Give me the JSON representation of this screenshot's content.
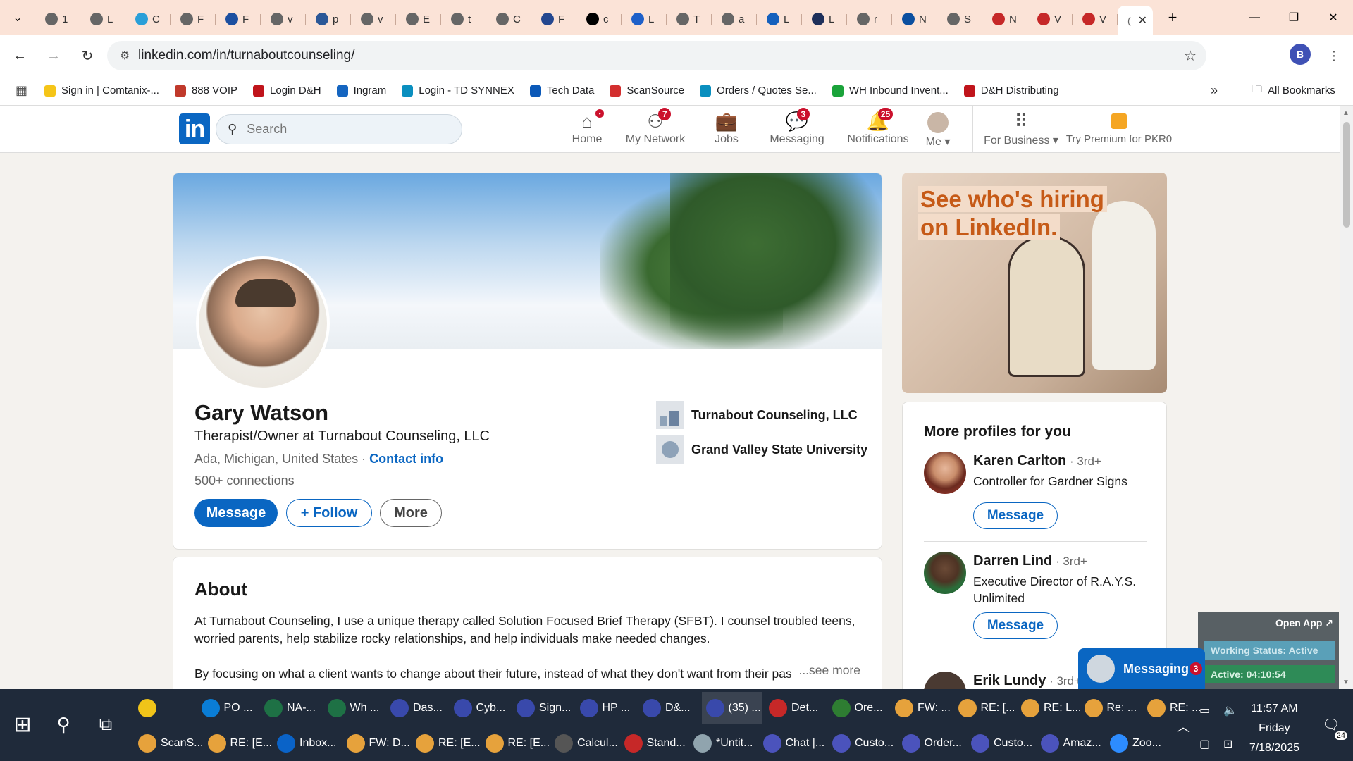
{
  "browser": {
    "url": "linkedin.com/in/turnaboutcounseling/",
    "tabs": [
      {
        "label": "1",
        "color": "#666"
      },
      {
        "label": "L",
        "color": "#666"
      },
      {
        "label": "C",
        "color": "#2a9fd8"
      },
      {
        "label": "F",
        "color": "#666"
      },
      {
        "label": "F",
        "color": "#1c4fa0"
      },
      {
        "label": "v",
        "color": "#666"
      },
      {
        "label": "p",
        "color": "#2b5797"
      },
      {
        "label": "v",
        "color": "#666"
      },
      {
        "label": "E",
        "color": "#666"
      },
      {
        "label": "t",
        "color": "#666"
      },
      {
        "label": "C",
        "color": "#666"
      },
      {
        "label": "F",
        "color": "#24478f"
      },
      {
        "label": "c",
        "color": "#000"
      },
      {
        "label": "L",
        "color": "#1e60c9"
      },
      {
        "label": "T",
        "color": "#666"
      },
      {
        "label": "a",
        "color": "#666"
      },
      {
        "label": "L",
        "color": "#1560bd"
      },
      {
        "label": "L",
        "color": "#1e2f5a"
      },
      {
        "label": "r",
        "color": "#666"
      },
      {
        "label": "N",
        "color": "#0b4fa0"
      },
      {
        "label": "S",
        "color": "#666"
      },
      {
        "label": "N",
        "color": "#c62828"
      },
      {
        "label": "V",
        "color": "#c62828"
      },
      {
        "label": "V",
        "color": "#c62828"
      }
    ],
    "active_tab_label": "(",
    "bookmarks": [
      {
        "label": "Sign in | Comtanix-...",
        "color": "#f5c518"
      },
      {
        "label": "888 VOIP",
        "color": "#c0392b"
      },
      {
        "label": "Login D&H",
        "color": "#c0141b"
      },
      {
        "label": "Ingram",
        "color": "#1565c0"
      },
      {
        "label": "Login - TD SYNNEX",
        "color": "#0a8fbf"
      },
      {
        "label": "Tech Data",
        "color": "#0b59b8"
      },
      {
        "label": "ScanSource",
        "color": "#d32f2f"
      },
      {
        "label": "Orders / Quotes Se...",
        "color": "#0a8fbf"
      },
      {
        "label": "WH Inbound Invent...",
        "color": "#1aa33a"
      },
      {
        "label": "D&H Distributing",
        "color": "#c0141b"
      }
    ],
    "all_bookmarks": "All Bookmarks",
    "profile_initial": "B"
  },
  "linkedin": {
    "search_placeholder": "Search",
    "nav": {
      "home": {
        "label": "Home",
        "badge": "•"
      },
      "network": {
        "label": "My Network",
        "badge": "7"
      },
      "jobs": {
        "label": "Jobs"
      },
      "messaging": {
        "label": "Messaging",
        "badge": "3"
      },
      "notifications": {
        "label": "Notifications",
        "badge": "25"
      },
      "me": {
        "label": "Me ▾"
      },
      "business": {
        "label": "For Business ▾"
      },
      "premium": {
        "label": "Try Premium for PKR0"
      }
    }
  },
  "profile": {
    "name": "Gary Watson",
    "headline": "Therapist/Owner at Turnabout Counseling, LLC",
    "location": "Ada, Michigan, United States",
    "separator": " · ",
    "contact_info": "Contact info",
    "connections": "500+ connections",
    "buttons": {
      "message": "Message",
      "follow": "+ Follow",
      "more": "More"
    },
    "company": "Turnabout Counseling, LLC",
    "school": "Grand Valley State University"
  },
  "about": {
    "title": "About",
    "para1": "At Turnabout Counseling, I use a unique therapy called Solution Focused Brief Therapy (SFBT). I counsel troubled teens, worried parents, help stabilize rocky relationships, and help individuals make needed changes.",
    "para2": "By focusing on what a client wants to change about their future, instead of what they don't want from their pas",
    "see_more": "...see more"
  },
  "ad": {
    "line1": "See who's hiring",
    "line2": "on LinkedIn."
  },
  "more_profiles": {
    "title": "More profiles for you",
    "items": [
      {
        "name": "Karen Carlton",
        "degree": " · 3rd+",
        "title": "Controller for Gardner Signs",
        "button": "Message"
      },
      {
        "name": "Darren Lind",
        "degree": " · 3rd+",
        "title": "Executive Director of R.A.Y.S. Unlimited",
        "button": "Message"
      },
      {
        "name": "Erik Lundy",
        "degree": " · 3rd+",
        "title": "",
        "button": ""
      }
    ]
  },
  "messaging_bar": {
    "label": "Messaging",
    "badge": "3"
  },
  "widget": {
    "open_app": "Open App ↗",
    "working_status": "Working Status: Active",
    "active_time": "Active: 04:10:54"
  },
  "taskbar": {
    "row1": [
      {
        "label": "",
        "color": "#f0c419"
      },
      {
        "label": "PO ...",
        "color": "#0a7dd6"
      },
      {
        "label": "NA-...",
        "color": "#1e7145"
      },
      {
        "label": "Wh ...",
        "color": "#1e7145"
      },
      {
        "label": "Das...",
        "color": "#3949ab"
      },
      {
        "label": "Cyb...",
        "color": "#3949ab"
      },
      {
        "label": "Sign...",
        "color": "#3949ab"
      },
      {
        "label": "HP ...",
        "color": "#3949ab"
      },
      {
        "label": "D&...",
        "color": "#3949ab"
      },
      {
        "label": "(35) ...",
        "color": "#3949ab"
      },
      {
        "label": "Det...",
        "color": "#c62828"
      },
      {
        "label": "Ore...",
        "color": "#2e7d32"
      },
      {
        "label": "FW: ...",
        "color": "#e6a23c"
      },
      {
        "label": "RE: [...",
        "color": "#e6a23c"
      },
      {
        "label": "RE: L...",
        "color": "#e6a23c"
      },
      {
        "label": "Re: ...",
        "color": "#e6a23c"
      },
      {
        "label": "RE: ...",
        "color": "#e6a23c"
      }
    ],
    "row2": [
      {
        "label": "ScanS...",
        "color": "#e6a23c"
      },
      {
        "label": "RE: [E...",
        "color": "#e6a23c"
      },
      {
        "label": "Inbox...",
        "color": "#0a63c8"
      },
      {
        "label": "FW: D...",
        "color": "#e6a23c"
      },
      {
        "label": "RE: [E...",
        "color": "#e6a23c"
      },
      {
        "label": "RE: [E...",
        "color": "#e6a23c"
      },
      {
        "label": "Calcul...",
        "color": "#555"
      },
      {
        "label": "Stand...",
        "color": "#c62828"
      },
      {
        "label": "*Untit...",
        "color": "#90a4ae"
      },
      {
        "label": "Chat |...",
        "color": "#4b53bc"
      },
      {
        "label": "Custo...",
        "color": "#4b53bc"
      },
      {
        "label": "Order...",
        "color": "#4b53bc"
      },
      {
        "label": "Custo...",
        "color": "#4b53bc"
      },
      {
        "label": "Amaz...",
        "color": "#4b53bc"
      },
      {
        "label": "Zoo...",
        "color": "#2d8cff"
      }
    ],
    "time": "11:57 AM",
    "day": "Friday",
    "date": "7/18/2025",
    "notification_count": "24"
  }
}
